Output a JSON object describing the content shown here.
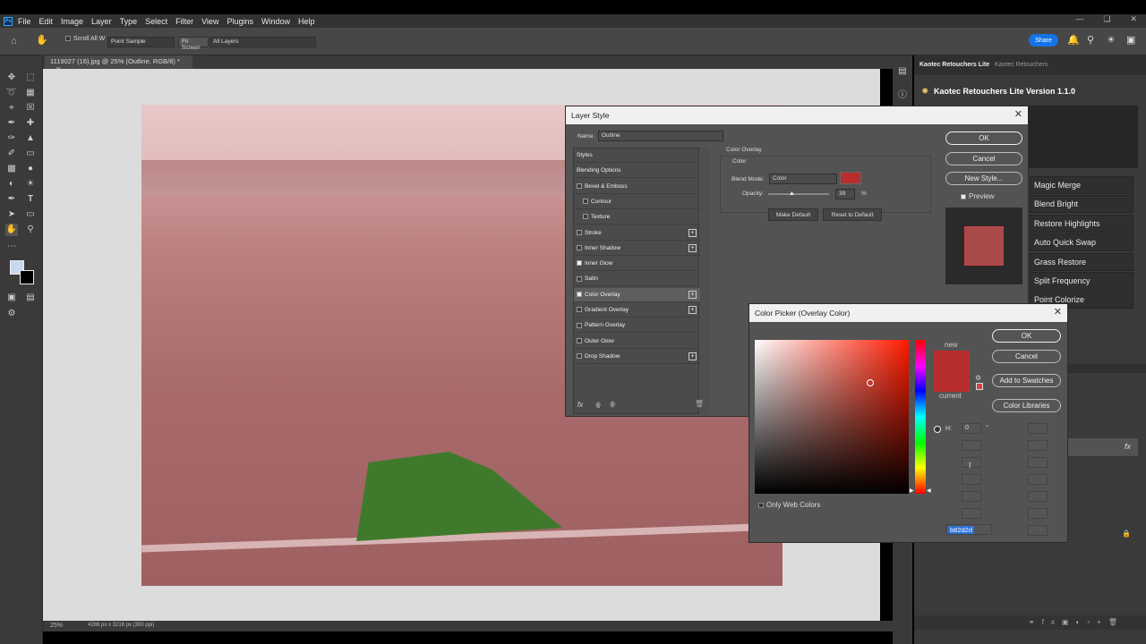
{
  "app": {
    "logo": "Ps",
    "menu": [
      "File",
      "Edit",
      "Image",
      "Layer",
      "Type",
      "Select",
      "Filter",
      "View",
      "Plugins",
      "Window",
      "Help"
    ]
  },
  "options": {
    "scroll_all": "Scroll All W",
    "sample": "Point Sample",
    "fit_screen": "Fit Screen",
    "all_layers": "All Layers",
    "share": "Share"
  },
  "document": {
    "tab": "1119027 (16).jpg @ 25% (Outline, RGB/8) *",
    "zoom": "25%",
    "info": "4288 px x 3216 px (300 ppi)"
  },
  "kaotec": {
    "tab1": "Kaotec Retouchers Lite",
    "tab2": "Kaotec Retouchers",
    "version": "Kaotec Retouchers Lite Version 1.1.0",
    "buttons": [
      "Magic Merge",
      "Blend Bright",
      "Restore Highlights",
      "Auto Quick Swap",
      "Grass Restore",
      "Split Frequency",
      "Point Colorize"
    ]
  },
  "layer_style": {
    "title": "Layer Style",
    "name_label": "Name:",
    "name_value": "Outline",
    "section": "Color Overlay",
    "subsection": "Color",
    "blend_label": "Blend Mode:",
    "blend_value": "Color",
    "opacity_label": "Opacity:",
    "opacity_value": "39",
    "opacity_unit": "%",
    "make_default": "Make Default",
    "reset_default": "Reset to Default",
    "ok": "OK",
    "cancel": "Cancel",
    "new_style": "New Style...",
    "preview": "Preview",
    "overlay_color": "#b82d2d",
    "styles": [
      {
        "label": "Styles",
        "cb": false,
        "plus": false,
        "head": true
      },
      {
        "label": "Blending Options",
        "cb": false,
        "plus": false,
        "head": true
      },
      {
        "label": "Bevel & Emboss",
        "cb": true,
        "on": false,
        "plus": false
      },
      {
        "label": "Contour",
        "cb": true,
        "on": false,
        "plus": false,
        "indent": true
      },
      {
        "label": "Texture",
        "cb": true,
        "on": false,
        "plus": false,
        "indent": true
      },
      {
        "label": "Stroke",
        "cb": true,
        "on": false,
        "plus": true
      },
      {
        "label": "Inner Shadow",
        "cb": true,
        "on": false,
        "plus": true
      },
      {
        "label": "Inner Glow",
        "cb": true,
        "on": true,
        "plus": false
      },
      {
        "label": "Satin",
        "cb": true,
        "on": false,
        "plus": false
      },
      {
        "label": "Color Overlay",
        "cb": true,
        "on": true,
        "plus": true,
        "sel": true
      },
      {
        "label": "Gradient Overlay",
        "cb": true,
        "on": false,
        "plus": true
      },
      {
        "label": "Pattern Overlay",
        "cb": true,
        "on": false,
        "plus": false
      },
      {
        "label": "Outer Glow",
        "cb": true,
        "on": false,
        "plus": false
      },
      {
        "label": "Drop Shadow",
        "cb": true,
        "on": false,
        "plus": true
      }
    ],
    "fx": "fx"
  },
  "color_picker": {
    "title": "Color Picker (Overlay Color)",
    "new_label": "new",
    "current_label": "current",
    "ok": "OK",
    "cancel": "Cancel",
    "add_swatches": "Add to Swatches",
    "color_libraries": "Color Libraries",
    "h_label": "H:",
    "h_value": "0",
    "h_unit": "°",
    "web_only": "Only Web Colors",
    "hex": "b82d2d",
    "new_color": "#b82d2d",
    "current_color": "#b82d2d"
  }
}
